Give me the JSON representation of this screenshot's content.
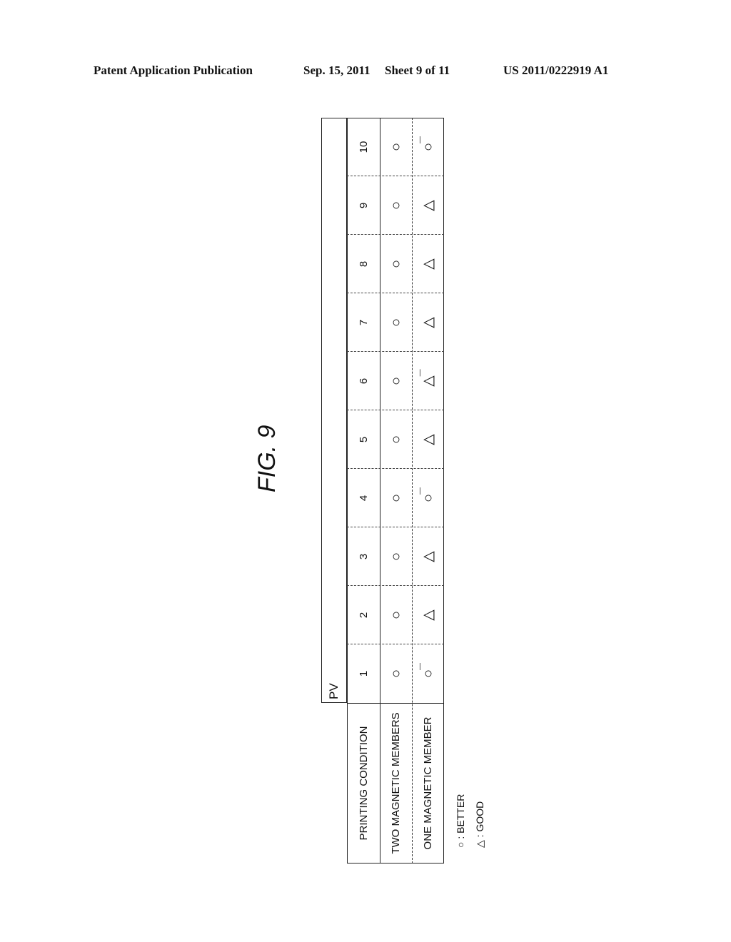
{
  "header": {
    "publication": "Patent Application Publication",
    "date": "Sep. 15, 2011",
    "sheet": "Sheet 9 of 11",
    "number": "US 2011/0222919 A1"
  },
  "figure": {
    "title": "FIG. 9"
  },
  "table": {
    "pv_label": "PV",
    "condition_label": "PRINTING CONDITION",
    "pv_values": [
      "1",
      "2",
      "3",
      "4",
      "5",
      "6",
      "7",
      "8",
      "9",
      "10"
    ],
    "rows": [
      {
        "label": "TWO MAGNETIC MEMBERS",
        "ratings": [
          "○",
          "○",
          "○",
          "○",
          "○",
          "○",
          "○",
          "○",
          "○",
          "○"
        ],
        "minus": [
          false,
          false,
          false,
          false,
          false,
          false,
          false,
          false,
          false,
          false
        ]
      },
      {
        "label": "ONE MAGNETIC MEMBER",
        "ratings": [
          "○",
          "△",
          "△",
          "○",
          "△",
          "△",
          "△",
          "△",
          "△",
          "○"
        ],
        "minus": [
          true,
          false,
          false,
          true,
          false,
          true,
          false,
          false,
          false,
          true
        ]
      }
    ]
  },
  "legend": [
    {
      "symbol": "○",
      "text": ": BETTER",
      "icon": "circle-icon"
    },
    {
      "symbol": "△",
      "text": ": GOOD",
      "icon": "triangle-icon"
    }
  ]
}
